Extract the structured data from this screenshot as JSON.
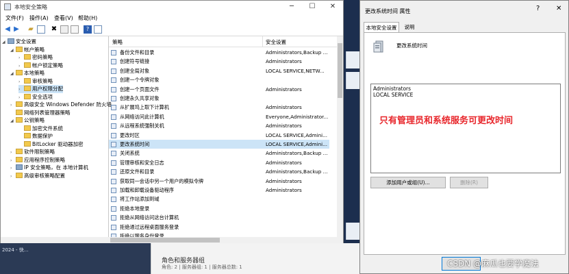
{
  "taskbar": {
    "item": "2024 - 快..."
  },
  "server_panel": {
    "title": "角色和服务器组",
    "subtitle": "角色: 2 | 服务器组: 1 | 服务器总数: 1"
  },
  "window": {
    "title": "本地安全策略",
    "controls": {
      "minimize": "─",
      "maximize": "☐",
      "close": "✕"
    },
    "menu": [
      "文件(F)",
      "操作(A)",
      "查看(V)",
      "帮助(H)"
    ]
  },
  "tree": [
    {
      "label": "安全设置",
      "indent": 0,
      "exp": "◢",
      "icon": "computer"
    },
    {
      "label": "帐户策略",
      "indent": 1,
      "exp": "◢",
      "icon": "folder"
    },
    {
      "label": "密码策略",
      "indent": 2,
      "exp": "›",
      "icon": "folder"
    },
    {
      "label": "帐户锁定策略",
      "indent": 2,
      "exp": "›",
      "icon": "folder"
    },
    {
      "label": "本地策略",
      "indent": 1,
      "exp": "◢",
      "icon": "folder"
    },
    {
      "label": "审核策略",
      "indent": 2,
      "exp": "›",
      "icon": "folder"
    },
    {
      "label": "用户权限分配",
      "indent": 2,
      "exp": "›",
      "icon": "folder",
      "selected": true
    },
    {
      "label": "安全选项",
      "indent": 2,
      "exp": "›",
      "icon": "folder"
    },
    {
      "label": "高级安全 Windows Defender 防火墙",
      "indent": 1,
      "exp": "›",
      "icon": "folder"
    },
    {
      "label": "网络列表管理器策略",
      "indent": 1,
      "exp": "",
      "icon": "folder"
    },
    {
      "label": "公钥策略",
      "indent": 1,
      "exp": "◢",
      "icon": "folder"
    },
    {
      "label": "加密文件系统",
      "indent": 2,
      "exp": "",
      "icon": "folder"
    },
    {
      "label": "数据保护",
      "indent": 2,
      "exp": "",
      "icon": "folder"
    },
    {
      "label": "BitLocker 驱动器加密",
      "indent": 2,
      "exp": "",
      "icon": "folder"
    },
    {
      "label": "软件限制策略",
      "indent": 1,
      "exp": "›",
      "icon": "folder"
    },
    {
      "label": "应用程序控制策略",
      "indent": 1,
      "exp": "›",
      "icon": "folder"
    },
    {
      "label": "IP 安全策略，在 本地计算机",
      "indent": 1,
      "exp": "›",
      "icon": "computer"
    },
    {
      "label": "高级审核策略配置",
      "indent": 1,
      "exp": "›",
      "icon": "folder"
    }
  ],
  "list": {
    "headers": {
      "policy": "策略",
      "setting": "安全设置"
    },
    "rows": [
      {
        "policy": "备份文件和目录",
        "setting": "Administrators,Backup ..."
      },
      {
        "policy": "创建符号链接",
        "setting": "Administrators"
      },
      {
        "policy": "创建全局对象",
        "setting": "LOCAL SERVICE,NETW..."
      },
      {
        "policy": "创建一个令牌对象",
        "setting": ""
      },
      {
        "policy": "创建一个页面文件",
        "setting": "Administrators"
      },
      {
        "policy": "创建永久共享对象",
        "setting": ""
      },
      {
        "policy": "从扩展坞上取下计算机",
        "setting": "Administrators"
      },
      {
        "policy": "从网络访问此计算机",
        "setting": "Everyone,Administrator..."
      },
      {
        "policy": "从远程系统强制关机",
        "setting": "Administrators"
      },
      {
        "policy": "更改时区",
        "setting": "LOCAL SERVICE,Admini..."
      },
      {
        "policy": "更改系统时间",
        "setting": "LOCAL SERVICE,Admini...",
        "selected": true
      },
      {
        "policy": "关闭系统",
        "setting": "Administrators,Backup ..."
      },
      {
        "policy": "管理审核和安全日志",
        "setting": "Administrators"
      },
      {
        "policy": "还原文件和目录",
        "setting": "Administrators,Backup ..."
      },
      {
        "policy": "获取同一会话中另一个用户的模拟令牌",
        "setting": "Administrators"
      },
      {
        "policy": "加载和卸载设备驱动程序",
        "setting": "Administrators"
      },
      {
        "policy": "将工作站添加到域",
        "setting": ""
      },
      {
        "policy": "拒绝本地登录",
        "setting": ""
      },
      {
        "policy": "拒绝从网络访问这台计算机",
        "setting": ""
      },
      {
        "policy": "拒绝通过远程桌面服务登录",
        "setting": ""
      },
      {
        "policy": "拒绝以服务身份登录",
        "setting": ""
      }
    ]
  },
  "dialog": {
    "title": "更改系统时间 属性",
    "help": "?",
    "close": "✕",
    "tabs": [
      "本地安全设置",
      "说明"
    ],
    "policy_name": "更改系统时间",
    "accounts": [
      "Administrators",
      "LOCAL SERVICE"
    ],
    "annotation": "只有管理员和系统服务可更改时间",
    "add_button": "添加用户或组(U)...",
    "remove_button": "删除(R)",
    "watermark": "CSDN @麻瓜也要学魔法"
  }
}
